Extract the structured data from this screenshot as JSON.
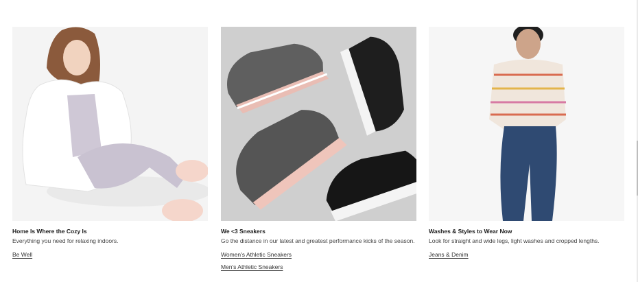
{
  "cards": [
    {
      "title": "Home Is Where the Cozy Is",
      "description": "Everything you need for relaxing indoors.",
      "links": [
        "Be Well"
      ]
    },
    {
      "title": "We <3 Sneakers",
      "description": "Go the distance in our latest and greatest performance kicks of the season.",
      "links": [
        "Women's Athletic Sneakers",
        "Men's Athletic Sneakers"
      ]
    },
    {
      "title": "Washes & Styles to Wear Now",
      "description": "Look for straight and wide legs, light washes and cropped lengths.",
      "links": [
        "Jeans & Denim"
      ]
    }
  ]
}
